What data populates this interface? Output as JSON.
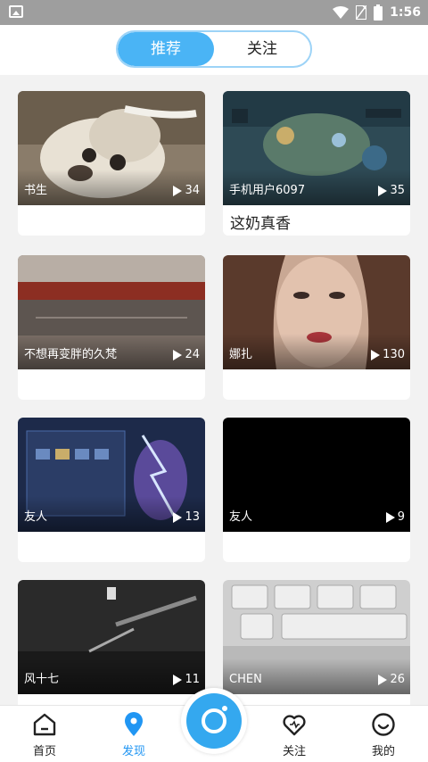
{
  "status_bar": {
    "time": "1:56"
  },
  "header": {
    "tabs": [
      {
        "label": "推荐",
        "active": true
      },
      {
        "label": "关注",
        "active": false
      }
    ]
  },
  "feed": [
    {
      "author": "书生",
      "plays": "34",
      "caption": "",
      "thumb": "dog"
    },
    {
      "author": "手机用户6097",
      "plays": "35",
      "caption": "这奶真香",
      "thumb": "game"
    },
    {
      "author": "不想再变胖的久梵",
      "plays": "24",
      "caption": "",
      "thumb": "room"
    },
    {
      "author": "娜扎",
      "plays": "130",
      "caption": "",
      "thumb": "face"
    },
    {
      "author": "友人",
      "plays": "13",
      "caption": "",
      "thumb": "game2"
    },
    {
      "author": "友人",
      "plays": "9",
      "caption": "",
      "thumb": "black"
    },
    {
      "author": "风十七",
      "plays": "11",
      "caption": "",
      "thumb": "dark"
    },
    {
      "author": "CHEN",
      "plays": "26",
      "caption": "",
      "thumb": "keyboard"
    }
  ],
  "bottom_nav": [
    {
      "label": "首页",
      "icon": "home-icon",
      "active": false
    },
    {
      "label": "发现",
      "icon": "location-pin-icon",
      "active": true
    },
    {
      "label": "关注",
      "icon": "heart-icon",
      "active": false
    },
    {
      "label": "我的",
      "icon": "smiley-icon",
      "active": false
    }
  ],
  "colors": {
    "accent": "#4ab4f5",
    "active_text": "#2196f3",
    "camera": "#34a8ef"
  }
}
